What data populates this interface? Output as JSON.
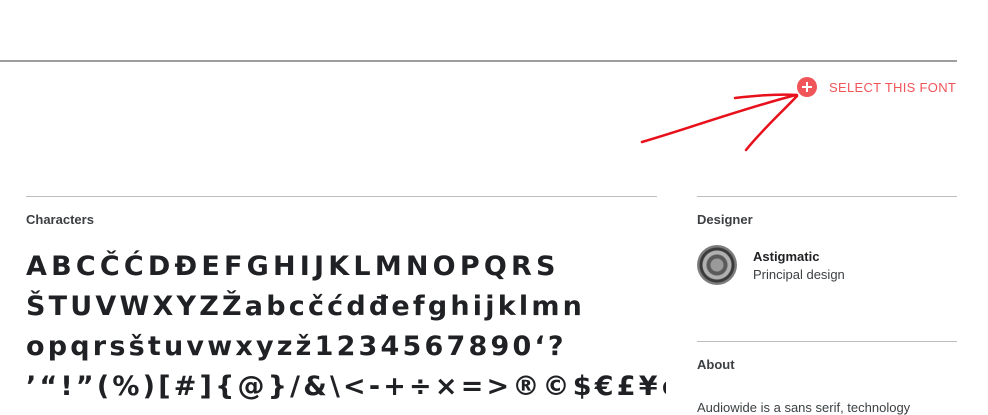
{
  "actions": {
    "select_font_label": "SELECT THIS FONT"
  },
  "characters": {
    "title": "Characters",
    "lines": [
      "ABCČĆDĐEFGHIJKLMNOPQRS",
      "ŠTUVWXYZŽabcčćdđefghijklmn",
      "opqrsštuvwxyzž1234567890‘?",
      "’“!”(%)[#]{@}/&\\<-+÷×=>®©$€£¥¢"
    ]
  },
  "designer": {
    "title": "Designer",
    "name": "Astigmatic",
    "role": "Principal design"
  },
  "about": {
    "title": "About",
    "text": "Audiowide is a sans serif, technology"
  },
  "colors": {
    "accent": "#f0555a",
    "annotation": "#e8101a",
    "rule": "#9e9e9e"
  }
}
